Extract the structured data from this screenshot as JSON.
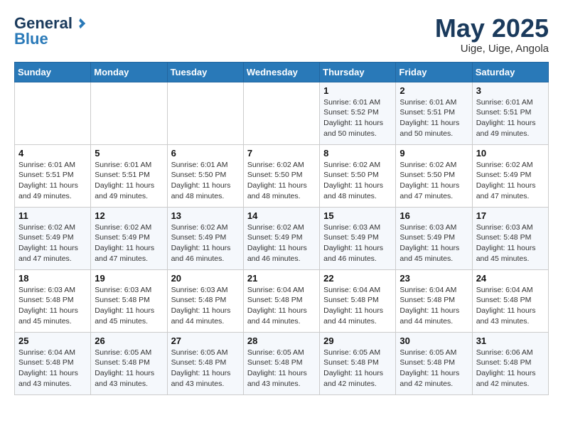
{
  "logo": {
    "general": "General",
    "blue": "Blue"
  },
  "title": "May 2025",
  "location": "Uige, Uige, Angola",
  "days_of_week": [
    "Sunday",
    "Monday",
    "Tuesday",
    "Wednesday",
    "Thursday",
    "Friday",
    "Saturday"
  ],
  "weeks": [
    [
      {
        "day": "",
        "info": ""
      },
      {
        "day": "",
        "info": ""
      },
      {
        "day": "",
        "info": ""
      },
      {
        "day": "",
        "info": ""
      },
      {
        "day": "1",
        "info": "Sunrise: 6:01 AM\nSunset: 5:52 PM\nDaylight: 11 hours and 50 minutes."
      },
      {
        "day": "2",
        "info": "Sunrise: 6:01 AM\nSunset: 5:51 PM\nDaylight: 11 hours and 50 minutes."
      },
      {
        "day": "3",
        "info": "Sunrise: 6:01 AM\nSunset: 5:51 PM\nDaylight: 11 hours and 49 minutes."
      }
    ],
    [
      {
        "day": "4",
        "info": "Sunrise: 6:01 AM\nSunset: 5:51 PM\nDaylight: 11 hours and 49 minutes."
      },
      {
        "day": "5",
        "info": "Sunrise: 6:01 AM\nSunset: 5:51 PM\nDaylight: 11 hours and 49 minutes."
      },
      {
        "day": "6",
        "info": "Sunrise: 6:01 AM\nSunset: 5:50 PM\nDaylight: 11 hours and 48 minutes."
      },
      {
        "day": "7",
        "info": "Sunrise: 6:02 AM\nSunset: 5:50 PM\nDaylight: 11 hours and 48 minutes."
      },
      {
        "day": "8",
        "info": "Sunrise: 6:02 AM\nSunset: 5:50 PM\nDaylight: 11 hours and 48 minutes."
      },
      {
        "day": "9",
        "info": "Sunrise: 6:02 AM\nSunset: 5:50 PM\nDaylight: 11 hours and 47 minutes."
      },
      {
        "day": "10",
        "info": "Sunrise: 6:02 AM\nSunset: 5:49 PM\nDaylight: 11 hours and 47 minutes."
      }
    ],
    [
      {
        "day": "11",
        "info": "Sunrise: 6:02 AM\nSunset: 5:49 PM\nDaylight: 11 hours and 47 minutes."
      },
      {
        "day": "12",
        "info": "Sunrise: 6:02 AM\nSunset: 5:49 PM\nDaylight: 11 hours and 47 minutes."
      },
      {
        "day": "13",
        "info": "Sunrise: 6:02 AM\nSunset: 5:49 PM\nDaylight: 11 hours and 46 minutes."
      },
      {
        "day": "14",
        "info": "Sunrise: 6:02 AM\nSunset: 5:49 PM\nDaylight: 11 hours and 46 minutes."
      },
      {
        "day": "15",
        "info": "Sunrise: 6:03 AM\nSunset: 5:49 PM\nDaylight: 11 hours and 46 minutes."
      },
      {
        "day": "16",
        "info": "Sunrise: 6:03 AM\nSunset: 5:49 PM\nDaylight: 11 hours and 45 minutes."
      },
      {
        "day": "17",
        "info": "Sunrise: 6:03 AM\nSunset: 5:48 PM\nDaylight: 11 hours and 45 minutes."
      }
    ],
    [
      {
        "day": "18",
        "info": "Sunrise: 6:03 AM\nSunset: 5:48 PM\nDaylight: 11 hours and 45 minutes."
      },
      {
        "day": "19",
        "info": "Sunrise: 6:03 AM\nSunset: 5:48 PM\nDaylight: 11 hours and 45 minutes."
      },
      {
        "day": "20",
        "info": "Sunrise: 6:03 AM\nSunset: 5:48 PM\nDaylight: 11 hours and 44 minutes."
      },
      {
        "day": "21",
        "info": "Sunrise: 6:04 AM\nSunset: 5:48 PM\nDaylight: 11 hours and 44 minutes."
      },
      {
        "day": "22",
        "info": "Sunrise: 6:04 AM\nSunset: 5:48 PM\nDaylight: 11 hours and 44 minutes."
      },
      {
        "day": "23",
        "info": "Sunrise: 6:04 AM\nSunset: 5:48 PM\nDaylight: 11 hours and 44 minutes."
      },
      {
        "day": "24",
        "info": "Sunrise: 6:04 AM\nSunset: 5:48 PM\nDaylight: 11 hours and 43 minutes."
      }
    ],
    [
      {
        "day": "25",
        "info": "Sunrise: 6:04 AM\nSunset: 5:48 PM\nDaylight: 11 hours and 43 minutes."
      },
      {
        "day": "26",
        "info": "Sunrise: 6:05 AM\nSunset: 5:48 PM\nDaylight: 11 hours and 43 minutes."
      },
      {
        "day": "27",
        "info": "Sunrise: 6:05 AM\nSunset: 5:48 PM\nDaylight: 11 hours and 43 minutes."
      },
      {
        "day": "28",
        "info": "Sunrise: 6:05 AM\nSunset: 5:48 PM\nDaylight: 11 hours and 43 minutes."
      },
      {
        "day": "29",
        "info": "Sunrise: 6:05 AM\nSunset: 5:48 PM\nDaylight: 11 hours and 42 minutes."
      },
      {
        "day": "30",
        "info": "Sunrise: 6:05 AM\nSunset: 5:48 PM\nDaylight: 11 hours and 42 minutes."
      },
      {
        "day": "31",
        "info": "Sunrise: 6:06 AM\nSunset: 5:48 PM\nDaylight: 11 hours and 42 minutes."
      }
    ]
  ]
}
